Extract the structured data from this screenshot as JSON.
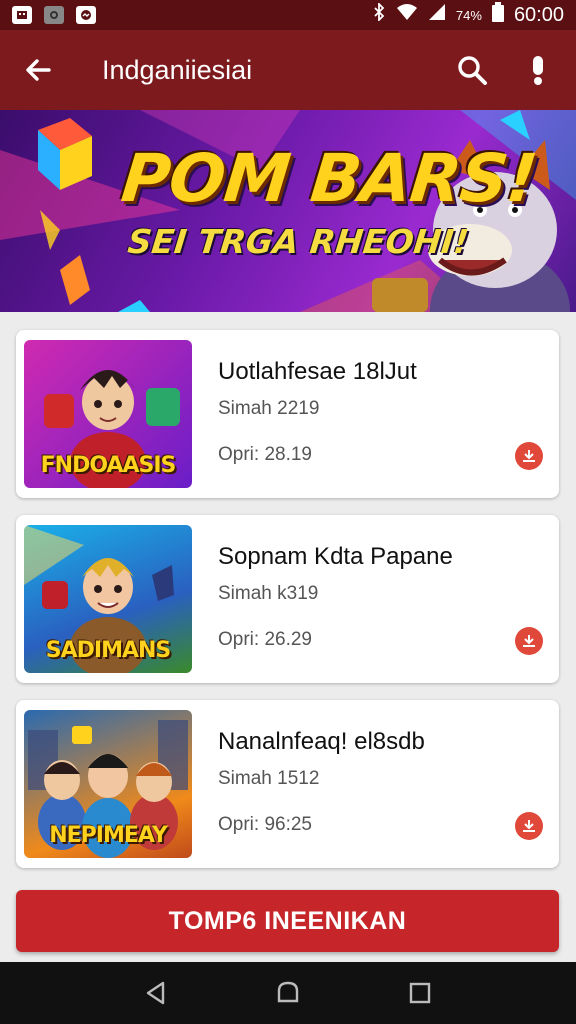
{
  "status_bar": {
    "battery_percent": "74%",
    "time": "60:00"
  },
  "app_bar": {
    "title": "Indganiiesiai"
  },
  "banner": {
    "title": "POM BARS!",
    "subtitle": "SEI TRGA RHEOHI!"
  },
  "games": [
    {
      "thumb_label": "FNDOAASIS",
      "title": "Uotlahfesae 18lJut",
      "subtitle": "Simah 2219",
      "meta": "Opri: 28.19",
      "thumb_colors": [
        "#c81fa0",
        "#6a1ec8"
      ]
    },
    {
      "thumb_label": "SADIMANS",
      "title": "Sopnam Kdta Papane",
      "subtitle": "Simah k319",
      "meta": "Opri: 26.29",
      "thumb_colors": [
        "#1aa0e0",
        "#2a60c0"
      ]
    },
    {
      "thumb_label": "NEPIMEAY",
      "title": "Nanalnfeaq! el8sdb",
      "subtitle": "Simah 1512",
      "meta": "Opri: 96:25",
      "thumb_colors": [
        "#f08a1a",
        "#2a7ad0"
      ]
    }
  ],
  "main_button": {
    "label": "TOMP6 INEENIKAN"
  },
  "colors": {
    "app_bar": "#7d1a1e",
    "status_bar": "#5a0f12",
    "accent": "#c6262a",
    "download": "#e0483a"
  }
}
